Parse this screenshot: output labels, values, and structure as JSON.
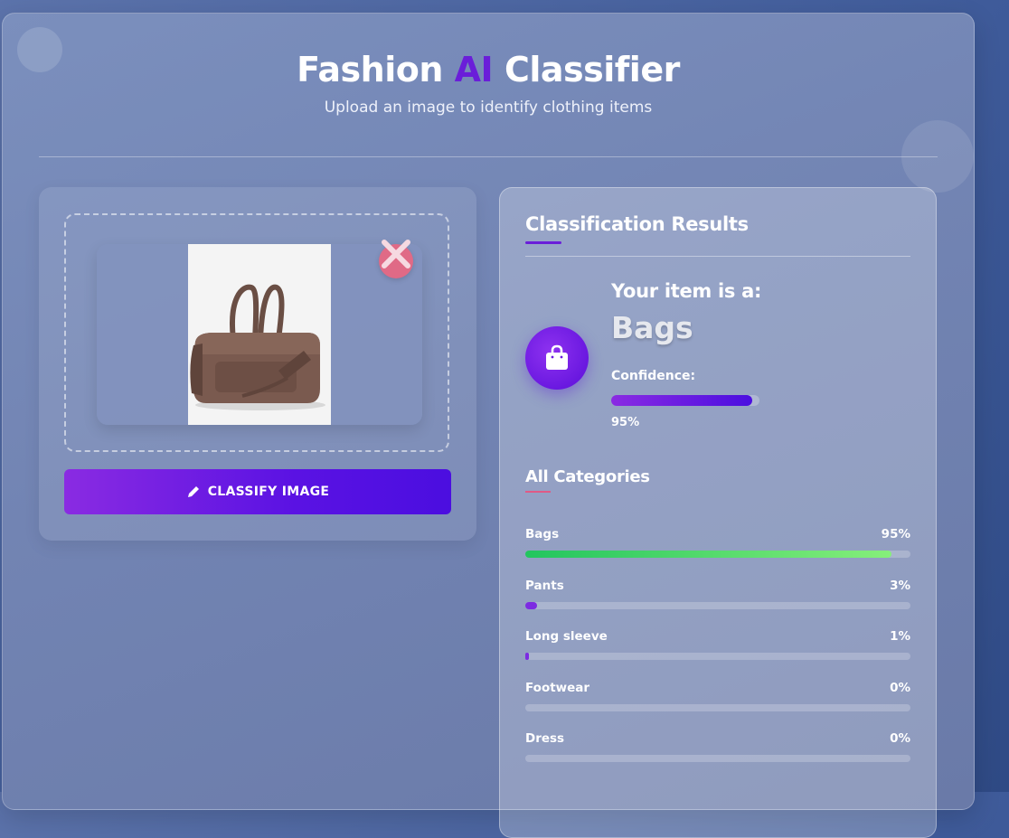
{
  "header": {
    "title_part1": "Fashion",
    "title_ai": "AI",
    "title_part2": "Classifier",
    "subtitle": "Upload an image to identify clothing items"
  },
  "upload": {
    "classify_button_label": "CLASSIFY IMAGE",
    "preview_icon": "handbag-photo",
    "remove_icon": "close-icon",
    "button_icon": "pencil-icon"
  },
  "results": {
    "title": "Classification Results",
    "your_item_label": "Your item is a:",
    "predicted_class": "Bags",
    "result_icon": "shopping-bag-icon",
    "confidence_label": "Confidence:",
    "confidence_value": "95%",
    "confidence_fraction": 0.95
  },
  "categories": {
    "title": "All Categories",
    "items": [
      {
        "name": "Bags",
        "percent": "95%",
        "value": 95
      },
      {
        "name": "Pants",
        "percent": "3%",
        "value": 3
      },
      {
        "name": "Long sleeve",
        "percent": "1%",
        "value": 1
      },
      {
        "name": "Footwear",
        "percent": "0%",
        "value": 0
      },
      {
        "name": "Dress",
        "percent": "0%",
        "value": 0
      }
    ]
  },
  "colors": {
    "accent": "#6a1ed9",
    "top_bar_start": "#22c55e",
    "top_bar_end": "#86ef7a",
    "other_bar": "#7c2be2",
    "remove_button": "#e06a86"
  }
}
